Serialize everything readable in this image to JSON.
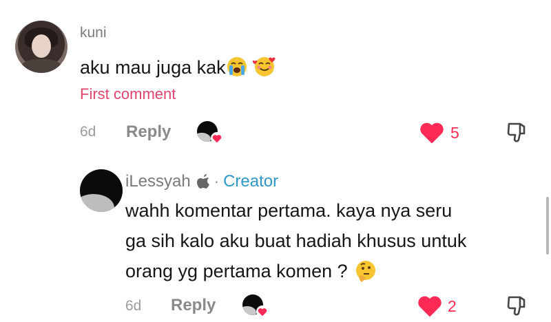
{
  "comment": {
    "username": "kuni",
    "text": "aku mau juga kak",
    "emojis": [
      "loudly-crying-face",
      "smiling-face-with-hearts"
    ],
    "badge": "First comment",
    "age": "6d",
    "reply_label": "Reply",
    "likes": "5"
  },
  "reply": {
    "username": "iLessyah",
    "separator": "·",
    "creator_label": "Creator",
    "lines": [
      "wahh komentar pertama. kaya nya seru",
      "ga sih kalo aku buat hadiah khusus untuk",
      "orang yg pertama komen ?"
    ],
    "emoji": "thinking-face",
    "age": "6d",
    "reply_label": "Reply",
    "likes": "2"
  },
  "colors": {
    "heart": "#ff2a55",
    "creator": "#2f97c9",
    "first_comment": "#e0436e"
  }
}
